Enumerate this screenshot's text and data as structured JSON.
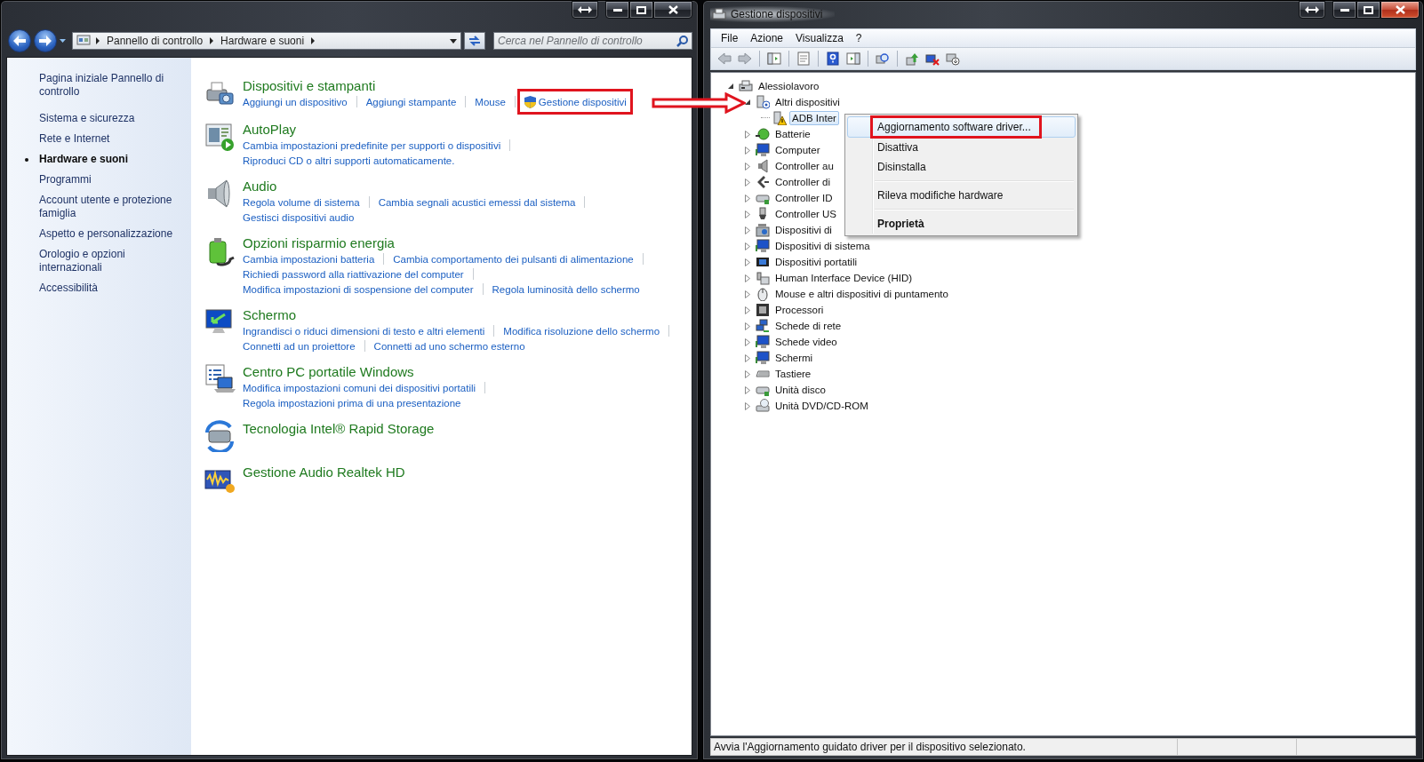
{
  "control_panel": {
    "active": false,
    "breadcrumb": [
      "Pannello di controllo",
      "Hardware e suoni"
    ],
    "search_placeholder": "Cerca nel Pannello di controllo",
    "sidebar": [
      {
        "label": "Pagina iniziale Pannello di controllo",
        "selected": false
      },
      {
        "label": "Sistema e sicurezza",
        "selected": false
      },
      {
        "label": "Rete e Internet",
        "selected": false
      },
      {
        "label": "Hardware e suoni",
        "selected": true
      },
      {
        "label": "Programmi",
        "selected": false
      },
      {
        "label": "Account utente e protezione famiglia",
        "selected": false
      },
      {
        "label": "Aspetto e personalizzazione",
        "selected": false
      },
      {
        "label": "Orologio e opzioni internazionali",
        "selected": false
      },
      {
        "label": "Accessibilità",
        "selected": false
      }
    ],
    "categories": [
      {
        "title": "Dispositivi e stampanti",
        "link_lines": [
          [
            {
              "label": "Aggiungi un dispositivo",
              "admin": false,
              "annotated": false
            },
            {
              "label": "Aggiungi stampante",
              "admin": false,
              "annotated": false
            },
            {
              "label": "Mouse",
              "admin": false,
              "annotated": false
            },
            {
              "label": "Gestione dispositivi",
              "admin": true,
              "annotated": true
            }
          ]
        ]
      },
      {
        "title": "AutoPlay",
        "link_lines": [
          [
            {
              "label": "Cambia impostazioni predefinite per supporti o dispositivi"
            }
          ],
          [
            {
              "label": "Riproduci CD o altri supporti automaticamente."
            }
          ]
        ]
      },
      {
        "title": "Audio",
        "link_lines": [
          [
            {
              "label": "Regola volume di sistema"
            },
            {
              "label": "Cambia segnali acustici emessi dal sistema"
            }
          ],
          [
            {
              "label": "Gestisci dispositivi audio"
            }
          ]
        ]
      },
      {
        "title": "Opzioni risparmio energia",
        "link_lines": [
          [
            {
              "label": "Cambia impostazioni batteria"
            },
            {
              "label": "Cambia comportamento dei pulsanti di alimentazione"
            }
          ],
          [
            {
              "label": "Richiedi password alla riattivazione del computer"
            }
          ],
          [
            {
              "label": "Modifica impostazioni di sospensione del computer"
            },
            {
              "label": "Regola luminosità dello schermo"
            }
          ]
        ]
      },
      {
        "title": "Schermo",
        "link_lines": [
          [
            {
              "label": "Ingrandisci o riduci dimensioni di testo e altri elementi"
            },
            {
              "label": "Modifica risoluzione dello schermo"
            }
          ],
          [
            {
              "label": "Connetti ad un proiettore"
            },
            {
              "label": "Connetti ad uno schermo esterno"
            }
          ]
        ]
      },
      {
        "title": "Centro PC portatile Windows",
        "link_lines": [
          [
            {
              "label": "Modifica impostazioni comuni dei dispositivi portatili"
            }
          ],
          [
            {
              "label": "Regola impostazioni prima di una presentazione"
            }
          ]
        ]
      },
      {
        "title": "Tecnologia Intel® Rapid Storage"
      },
      {
        "title": "Gestione Audio Realtek HD"
      }
    ]
  },
  "device_manager": {
    "active": true,
    "title": "Gestione dispositivi",
    "menu": [
      "File",
      "Azione",
      "Visualizza",
      "?"
    ],
    "tree": {
      "label": "Alessiolavoro",
      "expanded": true,
      "selected": false,
      "children": [
        {
          "label": "Altri dispositivi",
          "expanded": true,
          "selected": false,
          "children": [
            {
              "label": "ADB Inter",
              "selected": true,
              "problem": true
            }
          ]
        },
        {
          "label": "Batterie",
          "expanded": false,
          "selected": false
        },
        {
          "label": "Computer",
          "expanded": false,
          "selected": false
        },
        {
          "label": "Controller au",
          "expanded": false,
          "selected": false
        },
        {
          "label": "Controller di",
          "expanded": false,
          "selected": false
        },
        {
          "label": "Controller ID",
          "expanded": false,
          "selected": false
        },
        {
          "label": "Controller US",
          "expanded": false,
          "selected": false
        },
        {
          "label": "Dispositivi di",
          "expanded": false,
          "selected": false
        },
        {
          "label": "Dispositivi di sistema",
          "expanded": false,
          "selected": false
        },
        {
          "label": "Dispositivi portatili",
          "expanded": false,
          "selected": false
        },
        {
          "label": "Human Interface Device (HID)",
          "expanded": false,
          "selected": false
        },
        {
          "label": "Mouse e altri dispositivi di puntamento",
          "expanded": false,
          "selected": false
        },
        {
          "label": "Processori",
          "expanded": false,
          "selected": false
        },
        {
          "label": "Schede di rete",
          "expanded": false,
          "selected": false
        },
        {
          "label": "Schede video",
          "expanded": false,
          "selected": false
        },
        {
          "label": "Schermi",
          "expanded": false,
          "selected": false
        },
        {
          "label": "Tastiere",
          "expanded": false,
          "selected": false
        },
        {
          "label": "Unità disco",
          "expanded": false,
          "selected": false
        },
        {
          "label": "Unità DVD/CD-ROM",
          "expanded": false,
          "selected": false
        }
      ]
    },
    "context_menu": [
      {
        "kind": "item",
        "label": "Aggiornamento software driver...",
        "bold": false,
        "hovered": true,
        "annotated": true
      },
      {
        "kind": "item",
        "label": "Disattiva",
        "bold": false,
        "hovered": false,
        "annotated": false
      },
      {
        "kind": "item",
        "label": "Disinstalla",
        "bold": false,
        "hovered": false,
        "annotated": false
      },
      {
        "kind": "separator"
      },
      {
        "kind": "item",
        "label": "Rileva modifiche hardware",
        "bold": false,
        "hovered": false,
        "annotated": false
      },
      {
        "kind": "separator"
      },
      {
        "kind": "item",
        "label": "Proprietà",
        "bold": true,
        "hovered": false,
        "annotated": false
      }
    ],
    "status_bar": "Avvia l'Aggiornamento guidato driver per il dispositivo selezionato."
  }
}
